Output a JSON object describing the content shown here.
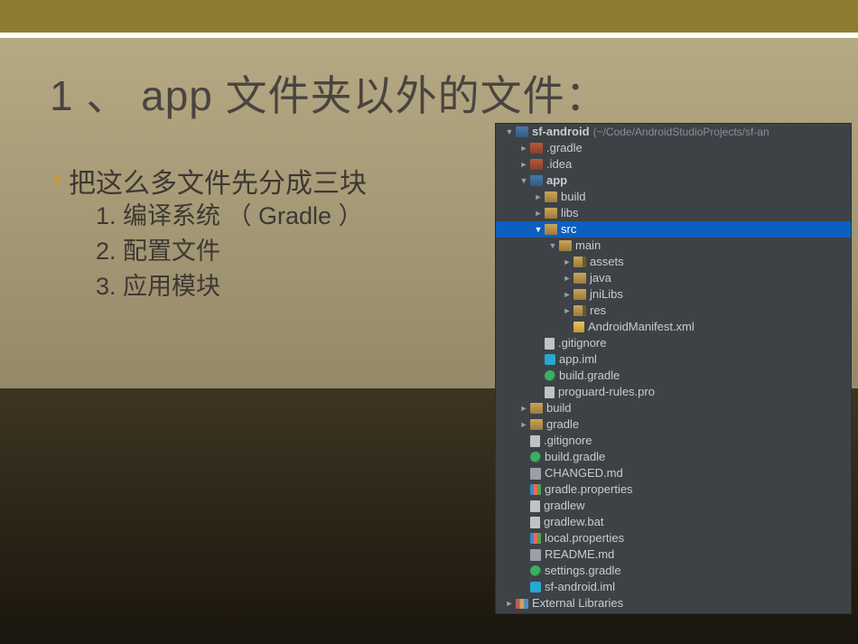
{
  "title": "1 、 app 文件夹以外的文件：",
  "bullet": "把这么多文件先分成三块",
  "list": [
    "1.  编译系统 （ Gradle ）",
    "2.  配置文件",
    "3.  应用模块"
  ],
  "tree": [
    {
      "depth": 0,
      "arrow": "▼",
      "icon": "ic-folder-blue",
      "label": "sf-android",
      "bold": true,
      "meta": "(~/Code/AndroidStudioProjects/sf-an",
      "sel": false
    },
    {
      "depth": 1,
      "arrow": "►",
      "icon": "ic-folder-red",
      "label": ".gradle"
    },
    {
      "depth": 1,
      "arrow": "►",
      "icon": "ic-folder-red",
      "label": ".idea"
    },
    {
      "depth": 1,
      "arrow": "▼",
      "icon": "ic-folder-blue",
      "label": "app",
      "bold": true
    },
    {
      "depth": 2,
      "arrow": "►",
      "icon": "ic-folder-tan",
      "label": "build"
    },
    {
      "depth": 2,
      "arrow": "►",
      "icon": "ic-folder-tan",
      "label": "libs"
    },
    {
      "depth": 2,
      "arrow": "▼",
      "icon": "ic-folder-tan",
      "label": "src",
      "sel": true
    },
    {
      "depth": 3,
      "arrow": "▼",
      "icon": "ic-folder-tan",
      "label": "main"
    },
    {
      "depth": 4,
      "arrow": "►",
      "icon": "ic-folder-pkg",
      "label": "assets"
    },
    {
      "depth": 4,
      "arrow": "►",
      "icon": "ic-folder-tan",
      "label": "java"
    },
    {
      "depth": 4,
      "arrow": "►",
      "icon": "ic-folder-tan",
      "label": "jniLibs"
    },
    {
      "depth": 4,
      "arrow": "►",
      "icon": "ic-folder-pkg",
      "label": "res"
    },
    {
      "depth": 4,
      "arrow": "",
      "icon": "ic-file-xml",
      "label": "AndroidManifest.xml"
    },
    {
      "depth": 2,
      "arrow": "",
      "icon": "ic-file",
      "label": ".gitignore"
    },
    {
      "depth": 2,
      "arrow": "",
      "icon": "ic-iml",
      "label": "app.iml"
    },
    {
      "depth": 2,
      "arrow": "",
      "icon": "ic-gradle",
      "label": "build.gradle"
    },
    {
      "depth": 2,
      "arrow": "",
      "icon": "ic-file",
      "label": "proguard-rules.pro"
    },
    {
      "depth": 1,
      "arrow": "►",
      "icon": "ic-folder-tan",
      "label": "build"
    },
    {
      "depth": 1,
      "arrow": "►",
      "icon": "ic-folder-tan",
      "label": "gradle"
    },
    {
      "depth": 1,
      "arrow": "",
      "icon": "ic-file",
      "label": ".gitignore"
    },
    {
      "depth": 1,
      "arrow": "",
      "icon": "ic-gradle",
      "label": "build.gradle"
    },
    {
      "depth": 1,
      "arrow": "",
      "icon": "ic-md",
      "label": "CHANGED.md"
    },
    {
      "depth": 1,
      "arrow": "",
      "icon": "ic-prop",
      "label": "gradle.properties"
    },
    {
      "depth": 1,
      "arrow": "",
      "icon": "ic-file",
      "label": "gradlew"
    },
    {
      "depth": 1,
      "arrow": "",
      "icon": "ic-file",
      "label": "gradlew.bat"
    },
    {
      "depth": 1,
      "arrow": "",
      "icon": "ic-prop",
      "label": "local.properties"
    },
    {
      "depth": 1,
      "arrow": "",
      "icon": "ic-md",
      "label": "README.md"
    },
    {
      "depth": 1,
      "arrow": "",
      "icon": "ic-gradle",
      "label": "settings.gradle"
    },
    {
      "depth": 1,
      "arrow": "",
      "icon": "ic-iml",
      "label": "sf-android.iml"
    },
    {
      "depth": 0,
      "arrow": "►",
      "icon": "ic-lib",
      "label": "External Libraries"
    }
  ]
}
